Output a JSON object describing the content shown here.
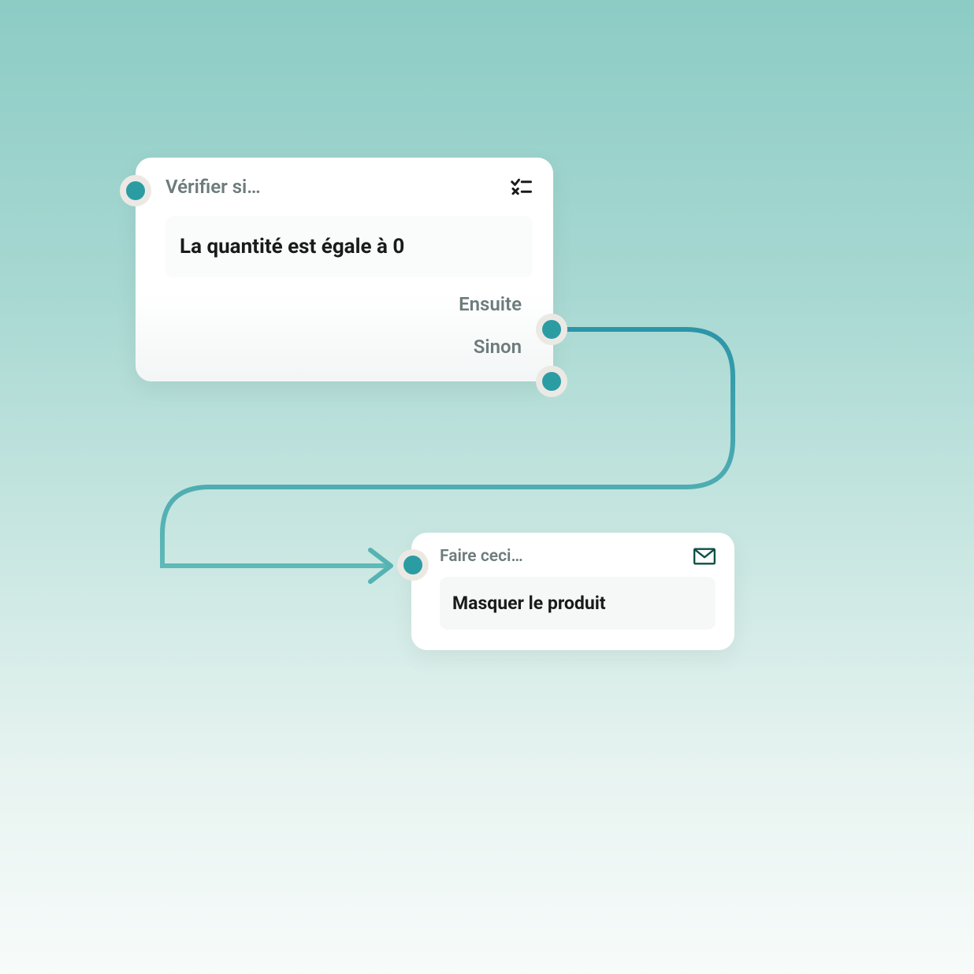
{
  "condition_node": {
    "title": "Vérifier si…",
    "condition_text": "La quantité est égale à 0",
    "output_then": "Ensuite",
    "output_else": "Sinon"
  },
  "action_node": {
    "title": "Faire ceci…",
    "action_text": "Masquer le produit"
  },
  "colors": {
    "accent": "#2c9ca3",
    "connector_start": "#2c95a8",
    "connector_end": "#5fb9b6"
  }
}
